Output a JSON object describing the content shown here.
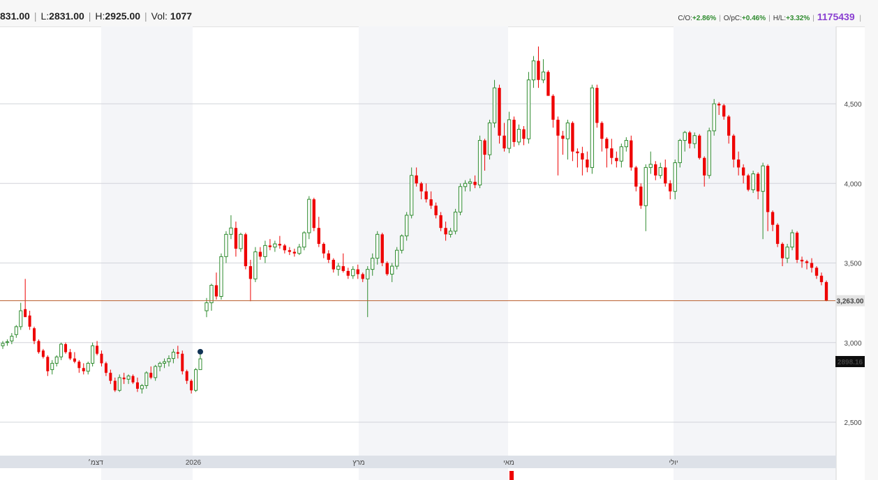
{
  "header": {
    "open_value": "831.00",
    "low_label": "L:",
    "low_value": "2831.00",
    "high_label": "H:",
    "high_value": "2925.00",
    "vol_label": "Vol:",
    "vol_value": "1077",
    "co_label": "C/O:",
    "co_value": "+2.86%",
    "opc_label": "O/pC:",
    "opc_value": "+0.46%",
    "hl_label": "H/L:",
    "hl_value": "+3.32%",
    "total_volume": "1175439",
    "pipe": "|"
  },
  "colors": {
    "up": "#2e8b2e",
    "down": "#ee0000",
    "shade": "#f4f5f8",
    "grid": "#d2d4da",
    "hline": "#b85c2a"
  },
  "price_labels": {
    "last_price": "3,263.00",
    "marker_price": "2898.16"
  },
  "chart_data": {
    "type": "candlestick",
    "title": "",
    "y_ticks": [
      {
        "value": 2500,
        "label": "2,500"
      },
      {
        "value": 3000,
        "label": "3,000"
      },
      {
        "value": 3500,
        "label": "3,500"
      },
      {
        "value": 4000,
        "label": "4,000"
      },
      {
        "value": 4500,
        "label": "4,500"
      }
    ],
    "y_range": [
      2250,
      4850
    ],
    "x_ticks": [
      "דצמ׳",
      "2026",
      "מרץ",
      "מאי",
      "יולי"
    ],
    "current_price_line": 3263,
    "series": [
      {
        "name": "segment-1",
        "ohlc": [
          [
            2980,
            3010,
            2960,
            2995
          ],
          [
            3000,
            3020,
            2980,
            3005
          ],
          [
            3010,
            3060,
            2990,
            3040
          ],
          [
            3050,
            3110,
            3030,
            3100
          ],
          [
            3100,
            3250,
            3080,
            3200
          ],
          [
            3210,
            3400,
            3170,
            3160
          ],
          [
            3170,
            3200,
            3080,
            3100
          ],
          [
            3090,
            3100,
            2990,
            3010
          ],
          [
            3010,
            3020,
            2930,
            2940
          ],
          [
            2950,
            2960,
            2900,
            2910
          ],
          [
            2910,
            2920,
            2790,
            2820
          ],
          [
            2830,
            2890,
            2800,
            2870
          ],
          [
            2870,
            2920,
            2850,
            2910
          ],
          [
            2910,
            3000,
            2890,
            2990
          ],
          [
            2990,
            3000,
            2930,
            2940
          ],
          [
            2940,
            2960,
            2890,
            2900
          ],
          [
            2900,
            2940,
            2870,
            2880
          ],
          [
            2880,
            2890,
            2810,
            2840
          ],
          [
            2840,
            2870,
            2800,
            2820
          ],
          [
            2820,
            2880,
            2800,
            2870
          ],
          [
            2870,
            3000,
            2850,
            2980
          ],
          [
            2980,
            3010,
            2920,
            2930
          ],
          [
            2930,
            2950,
            2850,
            2870
          ],
          [
            2870,
            2880,
            2790,
            2810
          ],
          [
            2810,
            2830,
            2740,
            2760
          ],
          [
            2760,
            2780,
            2690,
            2700
          ],
          [
            2700,
            2800,
            2690,
            2780
          ],
          [
            2780,
            2810,
            2740,
            2770
          ],
          [
            2770,
            2800,
            2740,
            2790
          ],
          [
            2790,
            2800,
            2740,
            2750
          ],
          [
            2750,
            2780,
            2690,
            2710
          ],
          [
            2710,
            2740,
            2680,
            2730
          ],
          [
            2730,
            2820,
            2710,
            2810
          ],
          [
            2810,
            2850,
            2770,
            2780
          ],
          [
            2780,
            2860,
            2760,
            2850
          ],
          [
            2850,
            2880,
            2820,
            2870
          ],
          [
            2870,
            2900,
            2840,
            2880
          ],
          [
            2880,
            2920,
            2850,
            2900
          ],
          [
            2900,
            2960,
            2870,
            2940
          ],
          [
            2940,
            2980,
            2900,
            2930
          ],
          [
            2930,
            2950,
            2800,
            2820
          ],
          [
            2820,
            2830,
            2740,
            2760
          ],
          [
            2760,
            2770,
            2680,
            2700
          ],
          [
            2700,
            2840,
            2690,
            2830
          ],
          [
            2830,
            2925,
            2831,
            2898
          ]
        ]
      },
      {
        "name": "segment-2",
        "ohlc": [
          [
            3200,
            3280,
            3160,
            3250
          ],
          [
            3250,
            3370,
            3200,
            3360
          ],
          [
            3360,
            3440,
            3270,
            3290
          ],
          [
            3290,
            3560,
            3270,
            3540
          ],
          [
            3540,
            3700,
            3500,
            3680
          ],
          [
            3680,
            3800,
            3650,
            3720
          ],
          [
            3720,
            3760,
            3540,
            3590
          ],
          [
            3590,
            3690,
            3570,
            3680
          ],
          [
            3680,
            3690,
            3460,
            3480
          ],
          [
            3480,
            3520,
            3260,
            3400
          ],
          [
            3400,
            3600,
            3380,
            3570
          ],
          [
            3570,
            3600,
            3520,
            3540
          ],
          [
            3540,
            3640,
            3500,
            3610
          ],
          [
            3610,
            3650,
            3580,
            3600
          ],
          [
            3600,
            3640,
            3570,
            3620
          ],
          [
            3620,
            3670,
            3590,
            3610
          ],
          [
            3610,
            3620,
            3560,
            3580
          ],
          [
            3580,
            3600,
            3550,
            3570
          ],
          [
            3570,
            3590,
            3540,
            3560
          ],
          [
            3560,
            3620,
            3550,
            3600
          ],
          [
            3600,
            3700,
            3580,
            3690
          ],
          [
            3690,
            3920,
            3650,
            3900
          ],
          [
            3900,
            3910,
            3700,
            3720
          ],
          [
            3720,
            3790,
            3600,
            3620
          ],
          [
            3620,
            3630,
            3530,
            3560
          ],
          [
            3560,
            3580,
            3500,
            3520
          ],
          [
            3520,
            3530,
            3440,
            3460
          ],
          [
            3460,
            3500,
            3420,
            3480
          ],
          [
            3480,
            3560,
            3440,
            3450
          ],
          [
            3450,
            3470,
            3400,
            3420
          ],
          [
            3420,
            3480,
            3400,
            3460
          ],
          [
            3460,
            3490,
            3400,
            3430
          ],
          [
            3430,
            3440,
            3380,
            3400
          ],
          [
            3400,
            3480,
            3160,
            3460
          ],
          [
            3460,
            3560,
            3420,
            3530
          ],
          [
            3530,
            3700,
            3490,
            3680
          ],
          [
            3680,
            3690,
            3480,
            3500
          ],
          [
            3500,
            3510,
            3420,
            3430
          ],
          [
            3430,
            3500,
            3380,
            3480
          ],
          [
            3480,
            3600,
            3460,
            3580
          ],
          [
            3580,
            3680,
            3560,
            3670
          ],
          [
            3670,
            3820,
            3640,
            3800
          ],
          [
            3800,
            4100,
            3780,
            4050
          ],
          [
            4050,
            4100,
            3980,
            4000
          ],
          [
            4000,
            4010,
            3900,
            3950
          ],
          [
            3950,
            4000,
            3880,
            3900
          ],
          [
            3900,
            3950,
            3840,
            3860
          ],
          [
            3860,
            3880,
            3780,
            3800
          ],
          [
            3800,
            3820,
            3700,
            3720
          ],
          [
            3720,
            3760,
            3640,
            3680
          ],
          [
            3680,
            3720,
            3660,
            3700
          ],
          [
            3700,
            3840,
            3680,
            3820
          ],
          [
            3820,
            4000,
            3800,
            3980
          ],
          [
            3980,
            4020,
            3950,
            4000
          ],
          [
            4000,
            4030,
            3950,
            4010
          ],
          [
            4010,
            4050,
            3970,
            3990
          ],
          [
            3990,
            4300,
            3970,
            4270
          ],
          [
            4270,
            4280,
            4080,
            4180
          ],
          [
            4180,
            4400,
            4150,
            4380
          ],
          [
            4380,
            4650,
            4350,
            4600
          ],
          [
            4600,
            4620,
            4250,
            4300
          ],
          [
            4300,
            4380,
            4200,
            4220
          ],
          [
            4220,
            4450,
            4190,
            4400
          ],
          [
            4400,
            4420,
            4230,
            4260
          ],
          [
            4260,
            4370,
            4240,
            4340
          ],
          [
            4340,
            4360,
            4240,
            4280
          ],
          [
            4280,
            4700,
            4250,
            4650
          ],
          [
            4650,
            4800,
            4600,
            4770
          ],
          [
            4770,
            4860,
            4600,
            4650
          ],
          [
            4650,
            4780,
            4630,
            4700
          ],
          [
            4700,
            4710,
            4550,
            4550
          ],
          [
            4550,
            4560,
            4350,
            4400
          ],
          [
            4400,
            4420,
            4050,
            4300
          ],
          [
            4300,
            4330,
            4180,
            4280
          ],
          [
            4280,
            4400,
            4150,
            4380
          ],
          [
            4380,
            4390,
            4140,
            4200
          ],
          [
            4200,
            4220,
            4100,
            4190
          ],
          [
            4190,
            4230,
            4050,
            4150
          ],
          [
            4150,
            4200,
            4070,
            4100
          ],
          [
            4100,
            4620,
            4060,
            4600
          ],
          [
            4600,
            4620,
            4350,
            4380
          ],
          [
            4380,
            4390,
            4200,
            4280
          ],
          [
            4280,
            4290,
            4100,
            4220
          ],
          [
            4220,
            4280,
            4120,
            4160
          ],
          [
            4160,
            4200,
            4100,
            4140
          ],
          [
            4140,
            4250,
            4100,
            4230
          ],
          [
            4230,
            4290,
            4200,
            4270
          ],
          [
            4270,
            4300,
            4080,
            4100
          ],
          [
            4100,
            4110,
            3950,
            3980
          ],
          [
            3980,
            4000,
            3840,
            3860
          ],
          [
            3860,
            4120,
            3700,
            4100
          ],
          [
            4100,
            4200,
            4060,
            4120
          ],
          [
            4120,
            4140,
            4020,
            4050
          ],
          [
            4050,
            4130,
            4030,
            4100
          ],
          [
            4100,
            4150,
            3980,
            4000
          ],
          [
            4000,
            4020,
            3900,
            3950
          ],
          [
            3950,
            4150,
            3900,
            4130
          ],
          [
            4130,
            4280,
            4100,
            4270
          ],
          [
            4270,
            4330,
            4200,
            4320
          ],
          [
            4320,
            4330,
            4220,
            4250
          ],
          [
            4250,
            4320,
            4220,
            4300
          ],
          [
            4300,
            4310,
            4150,
            4160
          ],
          [
            4160,
            4170,
            3980,
            4050
          ],
          [
            4050,
            4350,
            4030,
            4330
          ],
          [
            4330,
            4530,
            4300,
            4500
          ],
          [
            4500,
            4510,
            4430,
            4490
          ],
          [
            4490,
            4500,
            4400,
            4420
          ],
          [
            4420,
            4430,
            4250,
            4300
          ],
          [
            4300,
            4310,
            4100,
            4150
          ],
          [
            4150,
            4200,
            4050,
            4100
          ],
          [
            4100,
            4120,
            4000,
            4050
          ],
          [
            4050,
            4060,
            3950,
            3960
          ],
          [
            3960,
            4080,
            3940,
            4060
          ],
          [
            4060,
            4070,
            3900,
            3950
          ],
          [
            3950,
            4130,
            3650,
            4110
          ],
          [
            4110,
            4120,
            3700,
            3820
          ],
          [
            3820,
            3830,
            3700,
            3740
          ],
          [
            3740,
            3750,
            3600,
            3620
          ],
          [
            3620,
            3630,
            3480,
            3530
          ],
          [
            3530,
            3620,
            3500,
            3600
          ],
          [
            3600,
            3710,
            3580,
            3690
          ],
          [
            3690,
            3700,
            3500,
            3520
          ],
          [
            3520,
            3540,
            3470,
            3510
          ],
          [
            3510,
            3520,
            3460,
            3500
          ],
          [
            3500,
            3530,
            3440,
            3470
          ],
          [
            3470,
            3480,
            3400,
            3420
          ],
          [
            3420,
            3440,
            3360,
            3380
          ],
          [
            3380,
            3390,
            3260,
            3263
          ]
        ]
      }
    ]
  }
}
